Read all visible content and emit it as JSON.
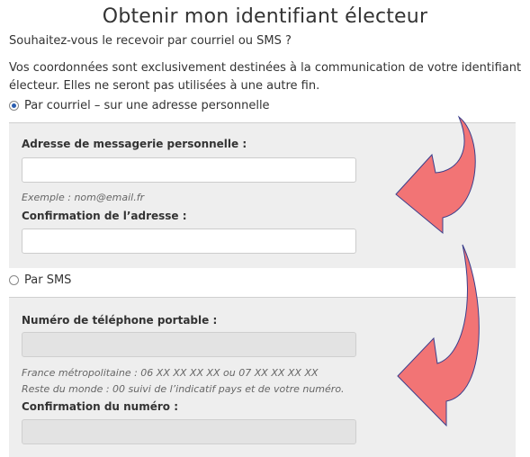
{
  "title": "Obtenir mon identifiant électeur",
  "question": "Souhaitez-vous le recevoir par courriel ou SMS ?",
  "info": "Vos coordonnées sont exclusivement destinées à la communication de votre identifiant électeur. Elles ne seront pas utilisées à une autre fin.",
  "options": {
    "email": {
      "label": "Par courriel – sur une adresse personnelle",
      "selected": true
    },
    "sms": {
      "label": "Par SMS",
      "selected": false
    }
  },
  "email_section": {
    "address_label": "Adresse de messagerie personnelle :",
    "address_value": "",
    "example": "Exemple : nom@email.fr",
    "confirm_label": "Confirmation de l’adresse :",
    "confirm_value": ""
  },
  "sms_section": {
    "phone_label": "Numéro de téléphone portable :",
    "phone_value": "",
    "help_line1": "France métropolitaine : 06 XX XX XX XX ou 07 XX XX XX XX",
    "help_line2": "Reste du monde : 00 suivi de l’indicatif pays et de votre numéro.",
    "confirm_label": "Confirmation du numéro :",
    "confirm_value": ""
  },
  "colors": {
    "arrow_fill": "#f27475",
    "arrow_stroke": "#3b3f8c",
    "panel": "#eeeeee"
  },
  "icons": [
    "radio-button-icon",
    "curved-arrow-icon"
  ]
}
